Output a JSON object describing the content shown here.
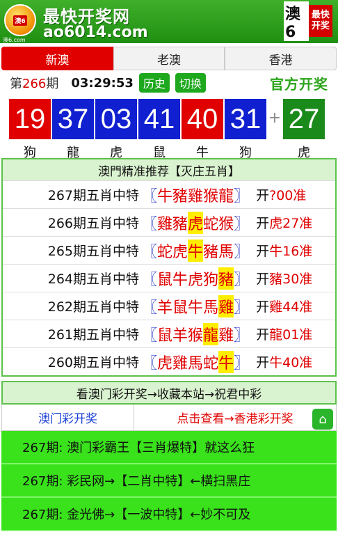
{
  "header": {
    "site_name": "最快开奖网",
    "domain": "ao6014.com",
    "logo_badge": "澳6",
    "logo_sub": "澳6.com",
    "mini_logo_text": "澳6",
    "mini_logo_box": [
      "最快",
      "开奖"
    ]
  },
  "tabs": [
    {
      "label": "新澳",
      "active": true
    },
    {
      "label": "老澳",
      "active": false
    },
    {
      "label": "香港",
      "active": false
    }
  ],
  "draw": {
    "prefix": "第",
    "issue": "266",
    "suffix": "期",
    "time": "03:29:53",
    "history_label": "历史",
    "switch_label": "切换",
    "official_label": "官方开奖"
  },
  "balls": [
    {
      "num": "19",
      "zodiac": "狗",
      "color": "#e00000"
    },
    {
      "num": "37",
      "zodiac": "龍",
      "color": "#1020d0"
    },
    {
      "num": "03",
      "zodiac": "虎",
      "color": "#1020d0"
    },
    {
      "num": "41",
      "zodiac": "鼠",
      "color": "#1020d0"
    },
    {
      "num": "40",
      "zodiac": "牛",
      "color": "#e00000"
    },
    {
      "num": "31",
      "zodiac": "狗",
      "color": "#1020d0"
    }
  ],
  "plus": "+",
  "special_ball": {
    "num": "27",
    "zodiac": "虎",
    "color": "#1a8a1a"
  },
  "recommend": {
    "title": "澳門精准推荐【灭庄五肖】",
    "rows": [
      {
        "label": "267期五肖中特",
        "zodiacs": [
          "牛",
          "豬",
          "雞",
          "猴",
          "龍"
        ],
        "hits": [],
        "open_label": "开",
        "result": "?00准"
      },
      {
        "label": "266期五肖中特",
        "zodiacs": [
          "雞",
          "豬",
          "虎",
          "蛇",
          "猴"
        ],
        "hits": [
          2
        ],
        "open_label": "开",
        "result": "虎27准"
      },
      {
        "label": "265期五肖中特",
        "zodiacs": [
          "蛇",
          "虎",
          "牛",
          "豬",
          "馬"
        ],
        "hits": [
          2
        ],
        "open_label": "开",
        "result": "牛16准"
      },
      {
        "label": "264期五肖中特",
        "zodiacs": [
          "鼠",
          "牛",
          "虎",
          "狗",
          "豬"
        ],
        "hits": [
          4
        ],
        "open_label": "开",
        "result": "豬30准"
      },
      {
        "label": "262期五肖中特",
        "zodiacs": [
          "羊",
          "鼠",
          "牛",
          "馬",
          "雞"
        ],
        "hits": [
          4
        ],
        "open_label": "开",
        "result": "雞44准"
      },
      {
        "label": "261期五肖中特",
        "zodiacs": [
          "鼠",
          "羊",
          "猴",
          "龍",
          "雞"
        ],
        "hits": [
          3
        ],
        "open_label": "开",
        "result": "龍01准"
      },
      {
        "label": "260期五肖中特",
        "zodiacs": [
          "虎",
          "雞",
          "馬",
          "蛇",
          "牛"
        ],
        "hits": [
          4
        ],
        "open_label": "开",
        "result": "牛40准"
      }
    ],
    "bracket_open": "〖",
    "bracket_close": "〗"
  },
  "notice": "看澳门彩开奖→收藏本站→祝君中彩",
  "links": {
    "left": "澳门彩开奖",
    "right": "点击查看→香港彩开奖",
    "home_icon": "home-icon"
  },
  "promos": [
    "267期: 澳门彩霸王【三肖爆特】就这么狂",
    "267期: 彩民网→【二肖中特】←横扫黑庄",
    "267期: 金光佛→【一波中特】←妙不可及"
  ]
}
